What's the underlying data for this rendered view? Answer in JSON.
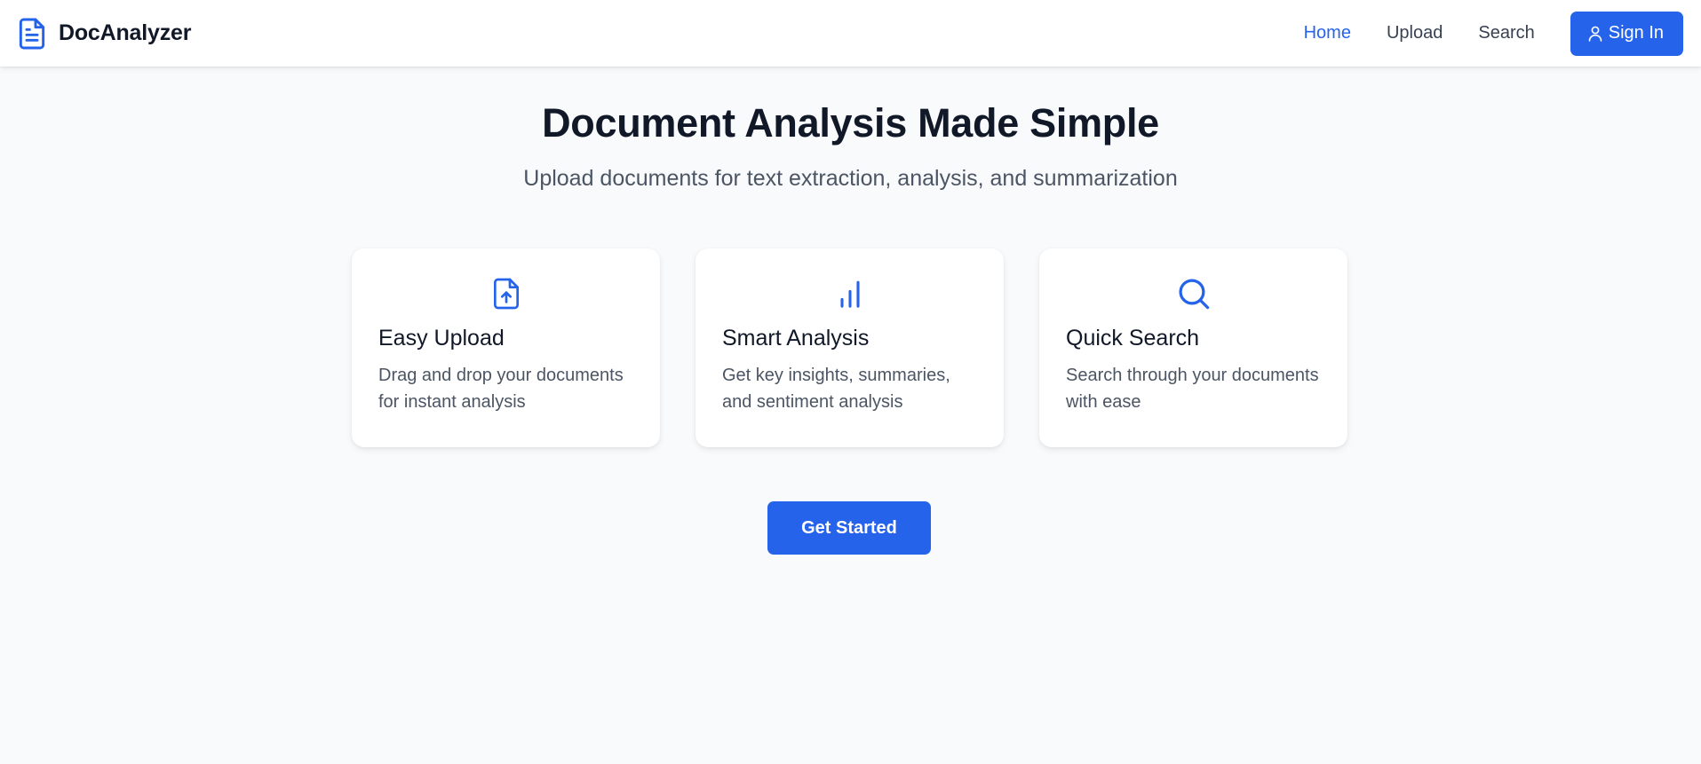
{
  "colors": {
    "accent": "#2563eb",
    "background": "#f8fafc",
    "text_primary": "#111827",
    "text_secondary": "#4b5563"
  },
  "navbar": {
    "brand_icon": "document-icon",
    "brand_name": "DocAnalyzer",
    "links": [
      {
        "label": "Home",
        "active": true
      },
      {
        "label": "Upload",
        "active": false
      },
      {
        "label": "Search",
        "active": false
      }
    ],
    "signin": {
      "icon": "user-icon",
      "label": "Sign In"
    }
  },
  "hero": {
    "title": "Document Analysis Made Simple",
    "subtitle": "Upload documents for text extraction, analysis, and summarization"
  },
  "features": [
    {
      "icon": "file-upload-icon",
      "title": "Easy Upload",
      "description": "Drag and drop your documents for instant analysis"
    },
    {
      "icon": "bar-chart-icon",
      "title": "Smart Analysis",
      "description": "Get key insights, summaries, and sentiment analysis"
    },
    {
      "icon": "search-icon",
      "title": "Quick Search",
      "description": "Search through your documents with ease"
    }
  ],
  "cta": {
    "label": "Get Started"
  }
}
